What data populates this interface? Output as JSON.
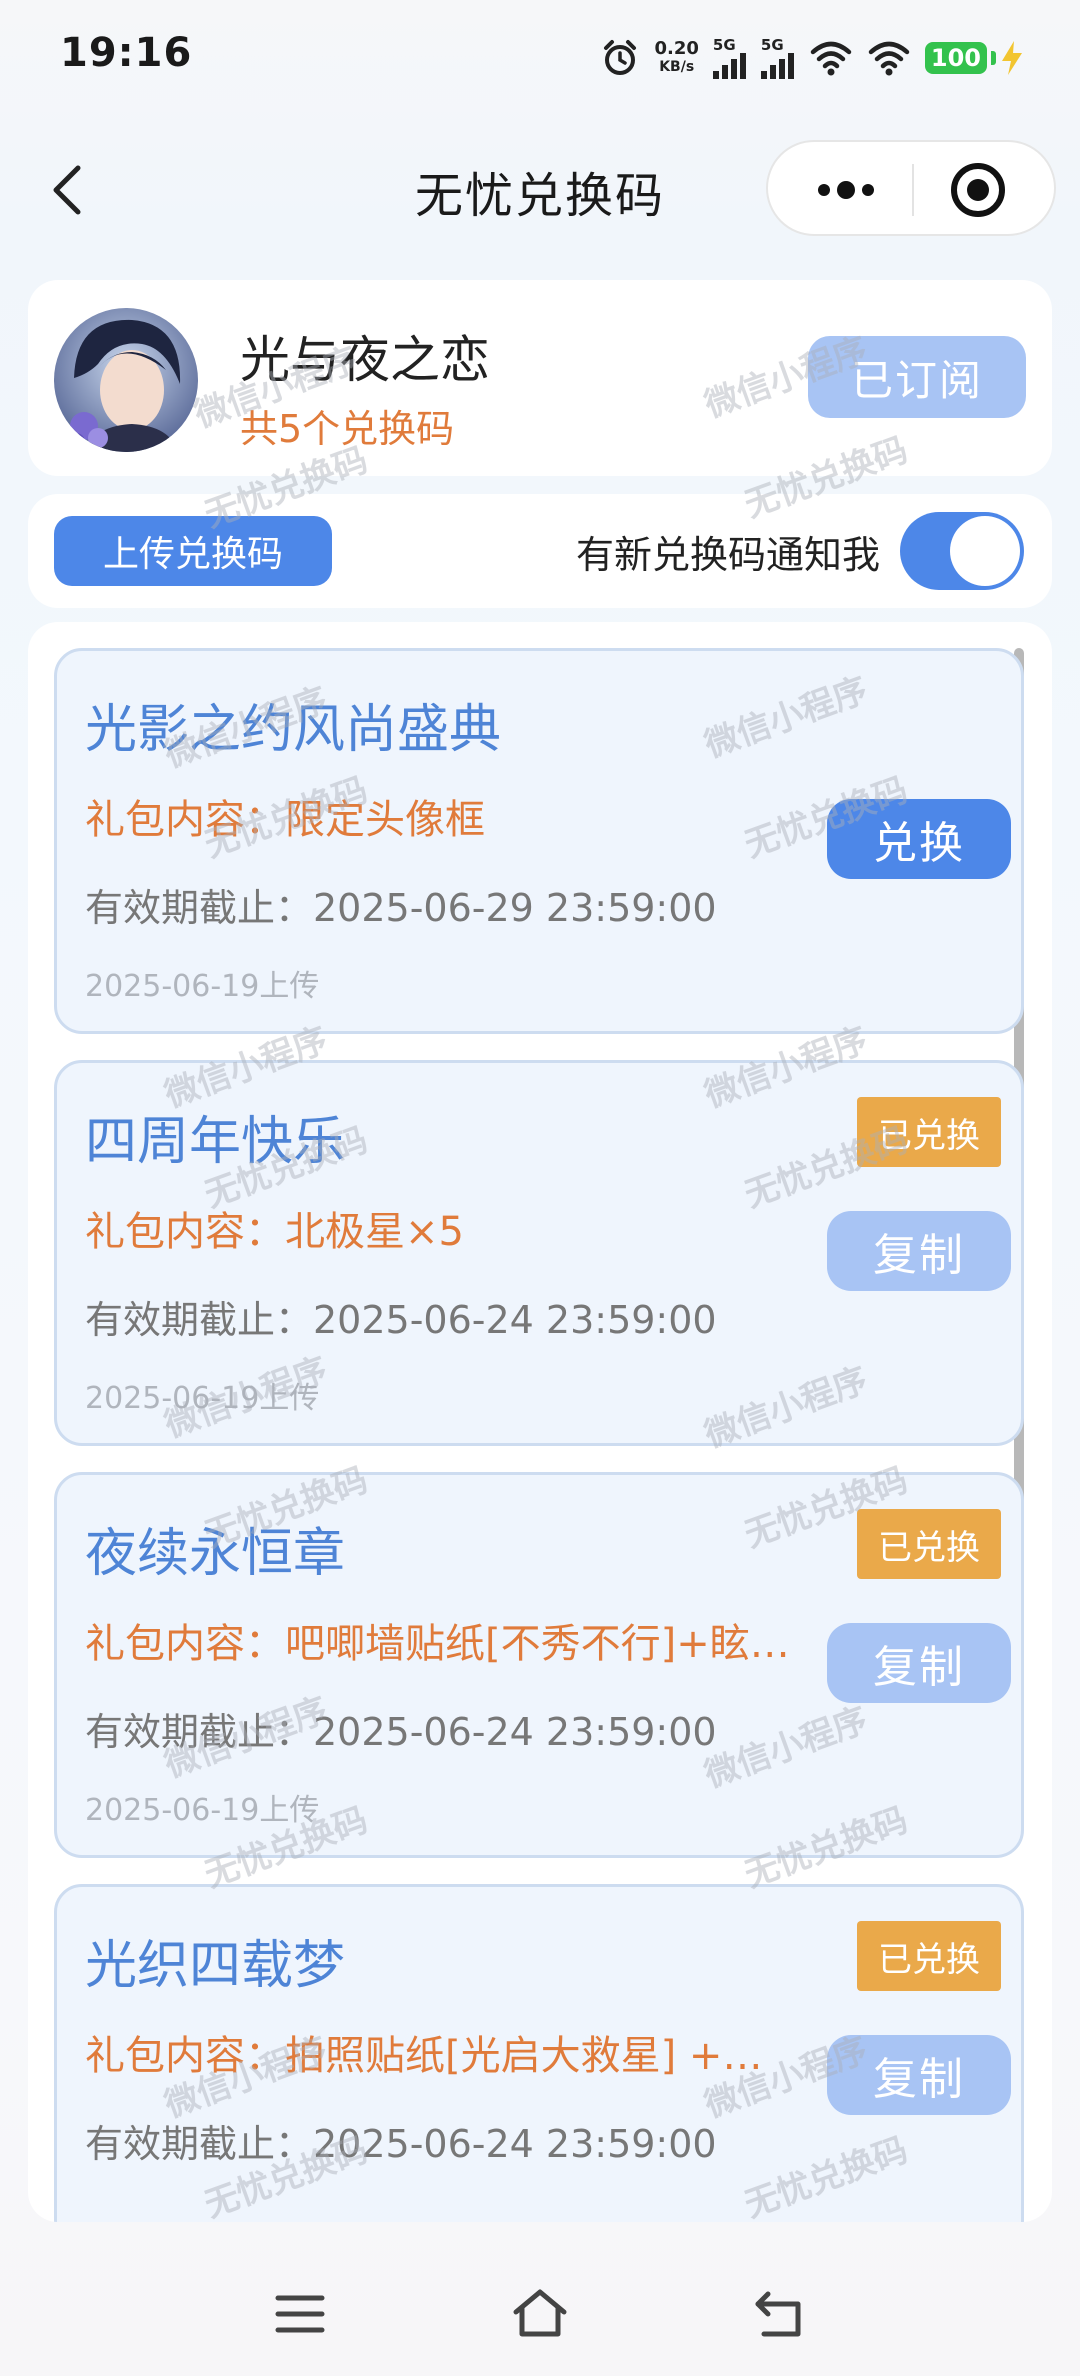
{
  "status_bar": {
    "time": "19:16",
    "net_speed_value": "0.20",
    "net_speed_unit": "KB/s",
    "signal1_label": "5G",
    "signal2_label": "5G",
    "battery": "100"
  },
  "nav": {
    "title": "无忧兑换码"
  },
  "profile": {
    "game_name": "光与夜之恋",
    "code_count": "共5个兑换码",
    "subscribe_label": "已订阅"
  },
  "actions": {
    "upload_label": "上传兑换码",
    "notify_label": "有新兑换码通知我",
    "notify_enabled": true
  },
  "codes": [
    {
      "title": "光影之约风尚盛典",
      "gift": "礼包内容：限定头像框",
      "expiry": "有效期截止：2025-06-29 23:59:00",
      "uploaded": "2025-06-19上传",
      "redeemed": false,
      "button_label": "兑换"
    },
    {
      "title": "四周年快乐",
      "gift": "礼包内容：北极星×5",
      "expiry": "有效期截止：2025-06-24 23:59:00",
      "uploaded": "2025-06-19上传",
      "redeemed": true,
      "badge_label": "已兑换",
      "button_label": "复制"
    },
    {
      "title": "夜续永恒章",
      "gift": "礼包内容：吧唧墙贴纸[不秀不行]+眩…",
      "expiry": "有效期截止：2025-06-24 23:59:00",
      "uploaded": "2025-06-19上传",
      "redeemed": true,
      "badge_label": "已兑换",
      "button_label": "复制"
    },
    {
      "title": "光织四载梦",
      "gift": "礼包内容：拍照贴纸[光启大救星] +…",
      "expiry": "有效期截止：2025-06-24 23:59:00",
      "uploaded": "",
      "redeemed": true,
      "badge_label": "已兑换",
      "button_label": "复制"
    }
  ],
  "watermarks": {
    "text_a": "微信小程序",
    "text_b": "无忧兑换码"
  },
  "colors": {
    "accent": "#4d87e8",
    "accent_light": "#a8c4f4",
    "gift_text": "#e07b3b",
    "badge": "#eaa94a",
    "title_text": "#4e84d6"
  }
}
